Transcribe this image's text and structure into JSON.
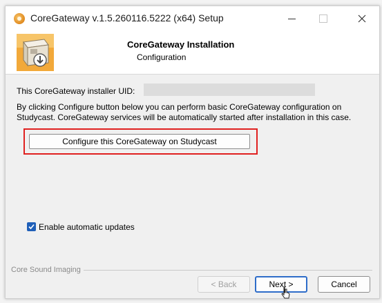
{
  "window": {
    "title": "CoreGateway v.1.5.260116.5222 (x64) Setup",
    "controls": {
      "minimize": "—",
      "maximize": "☐",
      "close": "✕"
    }
  },
  "header": {
    "title": "CoreGateway Installation",
    "subtitle": "Configuration",
    "logo_icon": "installer-box-icon"
  },
  "content": {
    "uid_label": "This CoreGateway installer UID:",
    "uid_value": "",
    "description": "By clicking Configure button below you can perform basic CoreGateway configuration on Studycast. CoreGateway services will be automatically started after installation in this case.",
    "configure_button": "Configure this CoreGateway on Studycast",
    "highlight_color": "#e0201f",
    "auto_update_label": "Enable automatic updates",
    "auto_update_checked": true
  },
  "footer": {
    "brand": "Core Sound Imaging",
    "back_label": "< Back",
    "next_label": "Next >",
    "cancel_label": "Cancel",
    "back_enabled": false
  },
  "colors": {
    "accent": "#2d6cc9",
    "checkbox": "#1f5fb8"
  }
}
